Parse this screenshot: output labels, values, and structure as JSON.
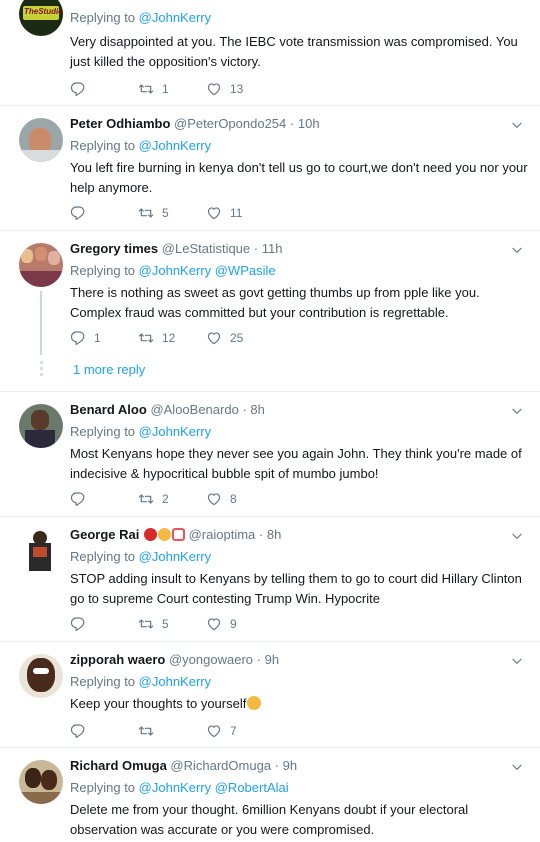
{
  "tweets": [
    {
      "name": "",
      "handle": "",
      "time": "",
      "replying_label": "Replying to",
      "mentions": "@JohnKerry",
      "text": "Very disappointed at you. The IEBC vote transmission was compromised. You just killed the opposition's victory.",
      "replies": "",
      "retweets": "1",
      "likes": "13",
      "avatar_text": "TheStudio"
    },
    {
      "name": "Peter Odhiambo",
      "handle": "@PeterOpondo254",
      "time": "10h",
      "replying_label": "Replying to",
      "mentions": "@JohnKerry",
      "text": "You left fire burning in kenya don't tell us go to court,we don't need you nor your help anymore.",
      "replies": "",
      "retweets": "5",
      "likes": "11"
    },
    {
      "name": "Gregory times",
      "handle": "@LeStatistique",
      "time": "11h",
      "replying_label": "Replying to",
      "mentions": "@JohnKerry @WPasile",
      "text": "There is nothing as sweet as govt getting thumbs up from pple like you. Complex fraud was committed but your contribution is regrettable.",
      "replies": "1",
      "retweets": "12",
      "likes": "25",
      "more_replies": "1 more reply"
    },
    {
      "name": "Benard Aloo",
      "handle": "@AlooBenardo",
      "time": "8h",
      "replying_label": "Replying to",
      "mentions": "@JohnKerry",
      "text": "Most Kenyans hope they never see you again John. They think you're made of indecisive & hypocritical bubble spit of mumbo jumbo!",
      "replies": "",
      "retweets": "2",
      "likes": "8"
    },
    {
      "name": "George Rai",
      "handle": "@raioptima",
      "time": "8h",
      "replying_label": "Replying to",
      "mentions": "@JohnKerry",
      "text": "STOP adding insult to Kenyans by telling them to go to court did Hillary Clinton go to supreme Court contesting  Trump  Win. Hypocrite",
      "replies": "",
      "retweets": "5",
      "likes": "9"
    },
    {
      "name": "zipporah waero",
      "handle": "@yongowaero",
      "time": "9h",
      "replying_label": "Replying to",
      "mentions": "@JohnKerry",
      "text": "Keep your thoughts to yourself",
      "replies": "",
      "retweets": "",
      "likes": "7"
    },
    {
      "name": "Richard Omuga",
      "handle": "@RichardOmuga",
      "time": "9h",
      "replying_label": "Replying to",
      "mentions": "@JohnKerry @RobertAlai",
      "text": "Delete me from your thought. 6million Kenyans doubt if your electoral observation was accurate or you were compromised.",
      "replies": "",
      "retweets": "",
      "likes": ""
    }
  ],
  "colors": {
    "link": "#1da1f2",
    "muted": "#657786",
    "divider": "#e6ecf0",
    "text": "#14171a",
    "heart_emoji": "#f0505a",
    "smile_emoji": "#f5b942"
  },
  "icons": [
    "reply-icon",
    "retweet-icon",
    "like-icon",
    "chevron-down-icon"
  ]
}
